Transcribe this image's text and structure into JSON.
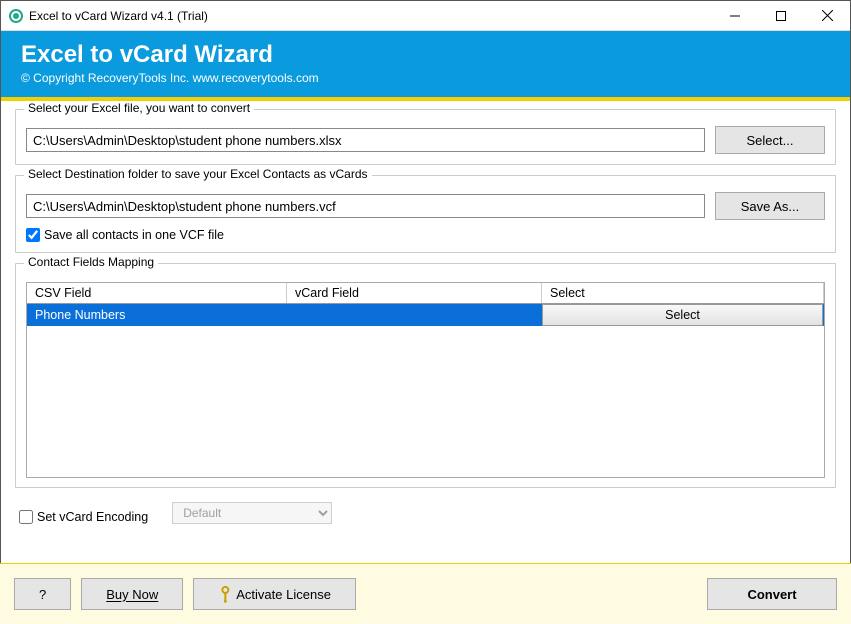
{
  "window": {
    "title": "Excel to vCard Wizard v4.1 (Trial)"
  },
  "header": {
    "title": "Excel to vCard Wizard",
    "subtitle": "© Copyright RecoveryTools Inc. www.recoverytools.com"
  },
  "source": {
    "legend": "Select your Excel file, you want to convert",
    "path": "C:\\Users\\Admin\\Desktop\\student phone numbers.xlsx",
    "button": "Select..."
  },
  "dest": {
    "legend": "Select Destination folder to save your Excel Contacts as vCards",
    "path": "C:\\Users\\Admin\\Desktop\\student phone numbers.vcf",
    "button": "Save As...",
    "saveall_label": "Save all contacts in one VCF file",
    "saveall_checked": true
  },
  "mapping": {
    "legend": "Contact Fields Mapping",
    "headers": {
      "csv": "CSV Field",
      "vcf": "vCard Field",
      "sel": "Select"
    },
    "rows": [
      {
        "csv": "Phone Numbers",
        "vcf": "",
        "select": "Select"
      }
    ]
  },
  "encoding": {
    "checkbox_label": "Set vCard Encoding",
    "value": "Default"
  },
  "footer": {
    "help": "?",
    "buy": "Buy Now",
    "activate": "Activate License",
    "convert": "Convert"
  }
}
